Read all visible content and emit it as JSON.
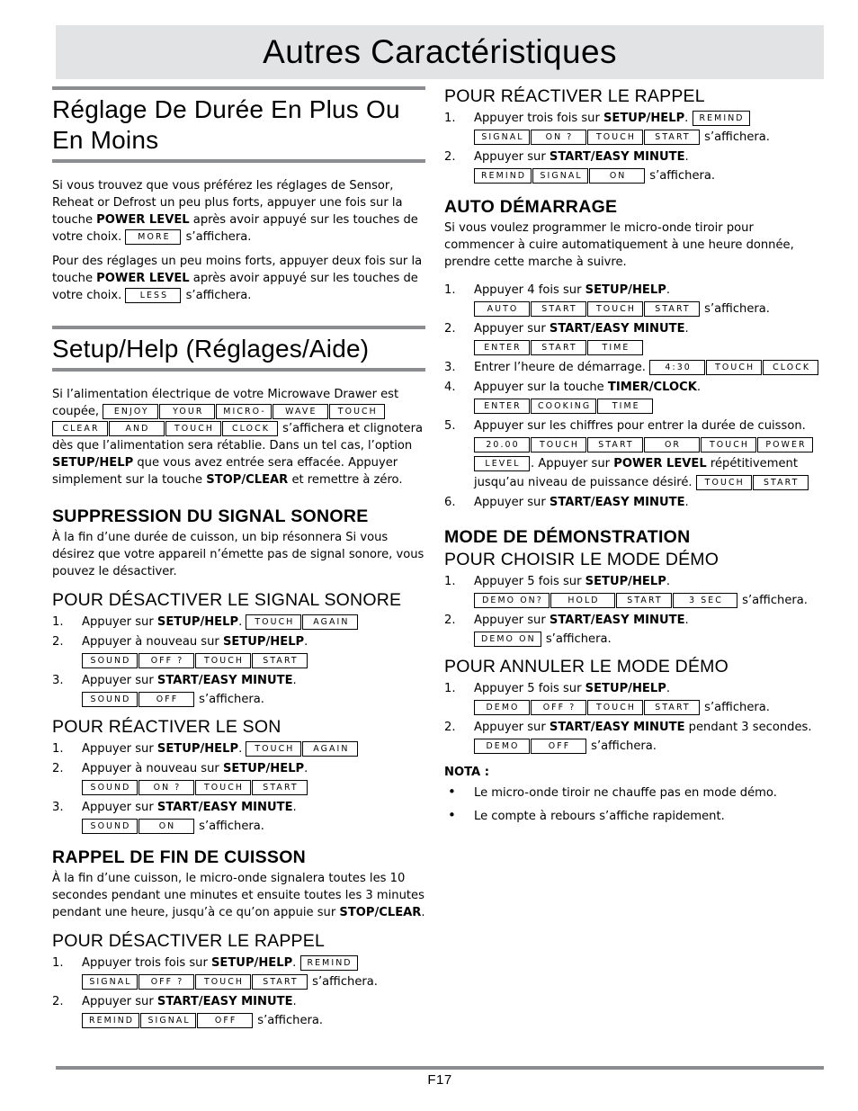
{
  "page": {
    "banner_title": "Autres Caractéristiques",
    "footer_page_number": "F17"
  },
  "left_column": {
    "section_more_less": {
      "heading": "Réglage De Durée En Plus Ou En Moins",
      "para1_a": "Si vous trouvez que vous préférez les réglages de Sensor, Reheat or Defrost un peu plus forts, appuyer une fois sur la touche ",
      "para1_bold": "POWER LEVEL",
      "para1_b": " après avoir appuyé sur les touches de votre choix. ",
      "para1_lcd": "MORE",
      "para1_c": " s’affichera.",
      "para2_a": "Pour des réglages un peu moins forts, appuyer deux fois sur la touche ",
      "para2_bold": "POWER LEVEL",
      "para2_b": " après avoir appuyé sur les touches de votre choix. ",
      "para2_lcd": "LESS",
      "para2_c": " s’affichera."
    },
    "section_setup_help": {
      "heading": "Setup/Help (Réglages/Aide)",
      "para_a": "Si l’alimentation électrique de votre Microwave Drawer est coupée, ",
      "lcd_1": "ENJOY",
      "lcd_2": "YOUR",
      "lcd_3": "MICRO-",
      "lcd_4": "WAVE",
      "lcd_5": "TOUCH",
      "lcd_6": "CLEAR",
      "lcd_7": "AND",
      "lcd_8": "TOUCH",
      "lcd_9": "CLOCK",
      "para_b": " s’affichera et clignotera dès que l’alimentation sera rétablie. Dans un tel cas, l’option ",
      "bold_1": "SETUP/HELP",
      "para_c": " que vous avez entrée sera effacée. Appuyer simplement sur la touche ",
      "bold_2": "STOP/CLEAR",
      "para_d": " et remettre à zéro."
    },
    "section_sound_off": {
      "heading": "SUPPRESSION DU SIGNAL SONORE",
      "intro": "À la fin d’une durée de cuisson, un bip résonnera Si vous désirez que votre appareil n’émette pas de signal sonore, vous pouvez le désactiver.",
      "sub_heading": "POUR DÉSACTIVER LE SIGNAL SONORE",
      "steps": [
        {
          "text_a": "Appuyer sur ",
          "bold": "SETUP/HELP",
          "text_b": ". ",
          "lcds": [
            "TOUCH",
            "AGAIN"
          ],
          "text_c": ""
        },
        {
          "text_a": "Appuyer à nouveau sur ",
          "bold": "SETUP/HELP",
          "text_b": ".",
          "lcds": [
            "SOUND",
            "OFF ?",
            "TOUCH",
            "START"
          ],
          "text_c": ""
        },
        {
          "text_a": "Appuyer sur ",
          "bold": "START/EASY MINUTE",
          "text_b": ".",
          "lcds": [
            "SOUND",
            "OFF"
          ],
          "text_c": " s’affichera."
        }
      ]
    },
    "section_sound_on": {
      "sub_heading": "POUR RÉACTIVER LE SON",
      "steps": [
        {
          "text_a": "Appuyer sur ",
          "bold": "SETUP/HELP",
          "text_b": ". ",
          "lcds": [
            "TOUCH",
            "AGAIN"
          ],
          "text_c": ""
        },
        {
          "text_a": "Appuyer à nouveau sur ",
          "bold": "SETUP/HELP",
          "text_b": ".",
          "lcds": [
            "SOUND",
            "ON ?",
            "TOUCH",
            "START"
          ],
          "text_c": ""
        },
        {
          "text_a": "Appuyer sur ",
          "bold": "START/EASY MINUTE",
          "text_b": ".",
          "lcds": [
            "SOUND",
            "ON"
          ],
          "text_c": " s’affichera."
        }
      ]
    },
    "section_reminder": {
      "heading": "RAPPEL DE FIN DE CUISSON",
      "intro_a": "À la fin d’une cuisson, le micro-onde signalera toutes les 10 secondes pendant une minutes et ensuite toutes les 3 minutes pendant une heure, jusqu’à ce qu’on appuie sur ",
      "intro_bold": "STOP/CLEAR",
      "intro_b": ".",
      "sub_heading": "POUR DÉSACTIVER LE RAPPEL",
      "steps": [
        {
          "text_a": "Appuyer trois fois sur ",
          "bold": "SETUP/HELP",
          "text_b": ". ",
          "lcds": [
            "REMIND",
            "SIGNAL",
            "OFF ?",
            "TOUCH",
            "START"
          ],
          "text_c": " s’affichera."
        },
        {
          "text_a": "Appuyer sur ",
          "bold": "START/EASY MINUTE",
          "text_b": ".",
          "lcds": [
            "REMIND",
            "SIGNAL",
            "OFF"
          ],
          "text_c": " s’affichera."
        }
      ]
    }
  },
  "right_column": {
    "section_reminder_on": {
      "sub_heading": "POUR RÉACTIVER LE RAPPEL",
      "steps": [
        {
          "text_a": "Appuyer trois fois sur ",
          "bold": "SETUP/HELP",
          "text_b": ". ",
          "lcds": [
            "REMIND",
            "SIGNAL",
            "ON ?",
            "TOUCH",
            "START"
          ],
          "text_c": " s’affichera."
        },
        {
          "text_a": "Appuyer sur ",
          "bold": "START/EASY MINUTE",
          "text_b": ".",
          "lcds": [
            "REMIND",
            "SIGNAL",
            "ON"
          ],
          "text_c": " s’affichera."
        }
      ]
    },
    "section_auto_start": {
      "heading": "AUTO DÉMARRAGE",
      "intro": "Si vous voulez programmer le micro-onde tiroir pour commencer à cuire automatiquement à une heure donnée, prendre cette marche à suivre.",
      "steps": [
        {
          "text_a": "Appuyer 4 fois sur ",
          "bold": "SETUP/HELP",
          "text_b": ".",
          "lcds": [
            "AUTO",
            "START",
            "TOUCH",
            "START"
          ],
          "text_c": " s’affichera."
        },
        {
          "text_a": "Appuyer sur ",
          "bold": "START/EASY MINUTE",
          "text_b": ".",
          "lcds": [
            "ENTER",
            "START",
            "TIME"
          ],
          "text_c": ""
        },
        {
          "text_a": "Entrer l’heure de démarrage. ",
          "bold": "",
          "text_b": "",
          "lcds": [
            "4:30",
            "TOUCH",
            "CLOCK"
          ],
          "text_c": ""
        },
        {
          "text_a": "Appuyer sur la touche ",
          "bold": "TIMER/CLOCK",
          "text_b": ".",
          "lcds": [
            "ENTER",
            "COOKING",
            "TIME"
          ],
          "text_c": ""
        },
        {
          "text_a": "Appuyer sur les chiffres pour entrer la durée de cuisson. ",
          "bold": "",
          "text_b": "",
          "lcds": [
            "20.00",
            "TOUCH",
            "START",
            "OR",
            "TOUCH",
            "POWER",
            "LEVEL"
          ],
          "text_c": ". Appuyer sur ",
          "bold2": "POWER LEVEL",
          "text_d": " répétitivement jusqu’au niveau de puissance désiré. ",
          "lcds2": [
            "TOUCH",
            "START"
          ]
        },
        {
          "text_a": "Appuyer sur ",
          "bold": "START/EASY MINUTE",
          "text_b": ".",
          "lcds": [],
          "text_c": ""
        }
      ]
    },
    "section_demo": {
      "heading": "MODE DE DÉMONSTRATION",
      "sub_heading_on": "POUR CHOISIR LE MODE DÉMO",
      "steps_on": [
        {
          "text_a": "Appuyer 5 fois sur ",
          "bold": "SETUP/HELP",
          "text_b": ".",
          "lcds": [
            "DEMO ON?",
            "HOLD",
            "START",
            "3 SEC"
          ],
          "text_c": " s’affichera."
        },
        {
          "text_a": "Appuyer sur ",
          "bold": "START/EASY MINUTE",
          "text_b": ".",
          "lcds": [
            "DEMO ON"
          ],
          "text_c": " s’affichera."
        }
      ],
      "sub_heading_off": "POUR ANNULER LE MODE DÉMO",
      "steps_off": [
        {
          "text_a": "Appuyer 5 fois sur ",
          "bold": "SETUP/HELP",
          "text_b": ".",
          "lcds": [
            "DEMO",
            "OFF ?",
            "TOUCH",
            "START"
          ],
          "text_c": " s’affichera."
        },
        {
          "text_a": "Appuyer sur ",
          "bold": "START/EASY MINUTE",
          "text_b": " pendant 3 secondes. ",
          "lcds": [
            "DEMO",
            "OFF"
          ],
          "text_c": " s’affichera."
        }
      ],
      "note_label": "NOTA :",
      "notes": [
        "Le micro-onde tiroir ne chauffe pas en mode démo.",
        "Le compte à rebours s’affiche rapidement."
      ]
    }
  }
}
